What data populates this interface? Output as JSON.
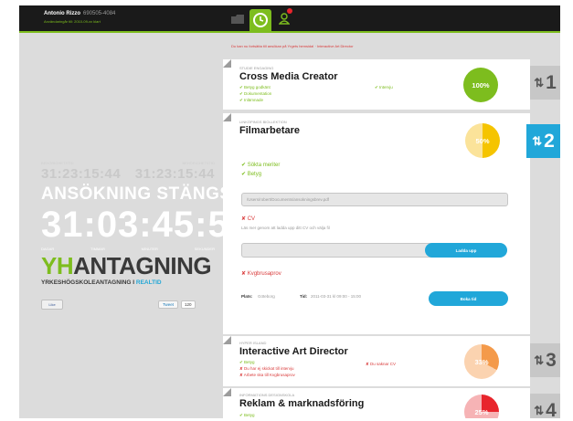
{
  "header": {
    "user_name": "Antonio Rizzo",
    "user_id": "690505-4084",
    "user_sub": "Användaringår till: 2010-09-xx klart",
    "nav_icons": [
      "folder-icon",
      "clock-icon",
      "user-icon"
    ]
  },
  "warning": "Du kan nu fortsätta till ansökan på Yrgets hemsida! · Interactive Art Director",
  "countdown": {
    "label_left": "BEHÖRIGHETSTID",
    "label_right": "BEHÖRIGHETSTID",
    "small_left": "31:23:15:44",
    "small_right": "31:23:15:44",
    "closes_label": "ANSÖKNING STÄNGS:",
    "big": "31:03:45:52",
    "units": [
      "DAGAR",
      "TIMMAR",
      "MINUTER",
      "SEKUNDER"
    ]
  },
  "brand": {
    "yh": "YH",
    "antagning": "ANTAGNING",
    "sub_main": "YRKESHÖGSKOLEANTAGNING I",
    "sub_highlight": "REALTID"
  },
  "social": {
    "like": "Like",
    "tweet": "Tweet",
    "tweet_count": "120"
  },
  "cards": [
    {
      "category": "STUDIE ENGAGING",
      "title": "Cross Media Creator",
      "checks": [
        "Betyg godkänt",
        "Dokumentation",
        "Inlämnade"
      ],
      "check_right": "Intervju",
      "percent": "100%",
      "rank": "1"
    },
    {
      "category": "LINKÖPINGS BIOLLEKTION",
      "title": "Filmarbetare",
      "checks": [
        "Sökta meriter",
        "Betyg"
      ],
      "file_value": "/Users/robert/Documents/ansokningsbrev.pdf",
      "cv_label": "CV",
      "cv_note": "Läs mer genom att ladda upp ditt CV och välja fil",
      "upload_label": "Ladda upp",
      "exam_label": "Kvgbrusaprov",
      "photo_label": "Plats:",
      "photo_value": "Göteborg",
      "time_label": "Tid:",
      "time_value": "2011-03-31 kl 09:00 - 15:00",
      "book_label": "Boka tid",
      "percent": "50%",
      "rank": "2"
    },
    {
      "category": "HYPER ISLAND",
      "title": "Interactive Art Director",
      "checks": [
        "Betyg"
      ],
      "crosses": [
        "Du har ej skickat till intervju",
        "Arbete ska till Kvgbrusaprov"
      ],
      "cross_right": "Du saknar CV",
      "percent": "33%",
      "rank": "3"
    },
    {
      "category": "INFORMATIONS DESIGNSKOLA",
      "title": "Reklam & marknadsföring",
      "checks": [
        "Betyg"
      ],
      "percent": "25%",
      "rank": "4"
    }
  ],
  "colors": {
    "accent_green": "#7dbd1e",
    "accent_blue": "#21a7d9",
    "error_red": "#d93a3a",
    "pie_yellow": "#f5c400",
    "pie_orange": "#f49a4a",
    "pie_red": "#e8252c"
  }
}
